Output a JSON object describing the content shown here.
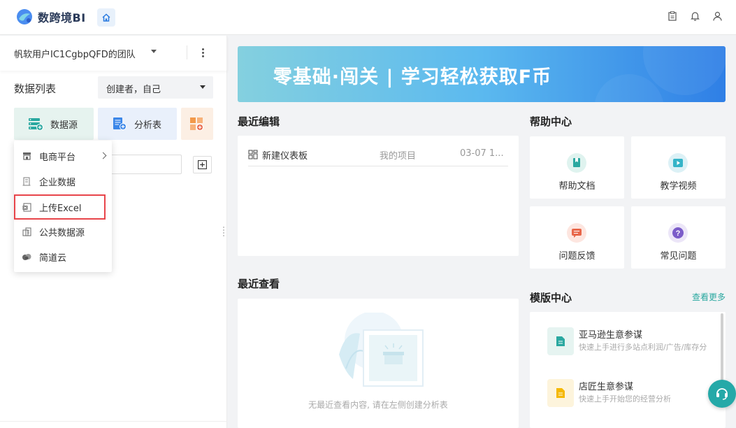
{
  "app": {
    "name": "数跨境BI",
    "brand_color": "#2b3b5a",
    "accent_color": "#2aa8a0"
  },
  "topbar": {
    "icons": [
      "home-icon",
      "clipboard-icon",
      "bell-icon",
      "user-icon"
    ]
  },
  "sidebar": {
    "team_name": "帆软用户IC1CgbpQFD的团队",
    "list_title": "数据列表",
    "creator_filter": "创建者，自己",
    "buttons": [
      {
        "label": "数据源",
        "icon": "datasource-add-icon"
      },
      {
        "label": "分析表",
        "icon": "analysis-table-add-icon"
      },
      {
        "label": "",
        "icon": "dashboard-add-icon"
      }
    ],
    "search_placeholder": ""
  },
  "dropdown": {
    "items": [
      {
        "label": "电商平台",
        "icon": "store-icon",
        "has_submenu": true
      },
      {
        "label": "企业数据",
        "icon": "building-icon",
        "has_submenu": false
      },
      {
        "label": "上传Excel",
        "icon": "excel-icon",
        "has_submenu": false,
        "highlighted": true
      },
      {
        "label": "公共数据源",
        "icon": "public-data-icon",
        "has_submenu": false
      },
      {
        "label": "简道云",
        "icon": "cloud-icon",
        "has_submenu": false
      }
    ]
  },
  "banner": {
    "text": "零基础·闯关 | 学习轻松获取F币"
  },
  "recent_edit": {
    "title": "最近编辑",
    "rows": [
      {
        "name": "新建仪表板",
        "project": "我的项目",
        "date": "03-07 1..."
      }
    ]
  },
  "recent_view": {
    "title": "最近查看",
    "empty_text": "无最近查看内容, 请在左侧创建分析表"
  },
  "help_center": {
    "title": "帮助中心",
    "items": [
      {
        "label": "帮助文档",
        "icon": "help-doc-icon",
        "color": "#2aa8a0"
      },
      {
        "label": "教学视频",
        "icon": "video-play-icon",
        "color": "#35b4c8"
      },
      {
        "label": "问题反馈",
        "icon": "feedback-icon",
        "color": "#e8674a"
      },
      {
        "label": "常见问题",
        "icon": "question-icon",
        "color": "#7b5cc9"
      }
    ]
  },
  "template_center": {
    "title": "模版中心",
    "more_link": "查看更多",
    "items": [
      {
        "name": "亚马逊生意参谋",
        "desc": "快速上手进行多站点利润/广告/库存分",
        "icon": "doc-green-icon",
        "color": "#2aa8a0"
      },
      {
        "name": "店匠生意参谋",
        "desc": "快速上手开始您的经营分析",
        "icon": "doc-yellow-icon",
        "color": "#f5b800"
      }
    ]
  }
}
